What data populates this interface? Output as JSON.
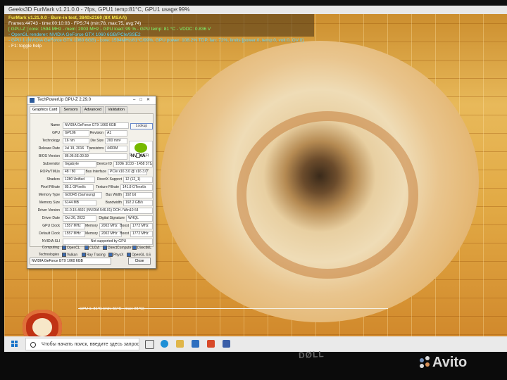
{
  "window": {
    "title": "Geeks3D FurMark v1.21.0.0 - 7fps, GPU1 temp:81°C, GPU1 usage:99%"
  },
  "hud": {
    "line1": "FurMark v1.21.0.0 - Burn-in test, 3840x2160 (8X MSAA)",
    "line2": "Frames:44743 - time:00:10:03 - FPS:74 (min:78, max:75, avg:74)",
    "line3": "[ GPU-Z ] core: 1594 MHz - mem: 2003 MHz - GPU load: 99 % - GPU temp: 81 °C - VDDC: 0.836 V",
    "line4": "- OpenGL renderer: NVIDIA GeForce GTX 1060 6GB/PCIe/SSE2",
    "line5": "- GPU 1 (NVIDIA GeForce GTX 1060 6GB) - core: 1594MHz/81°C/99%, GPU power: 108.2% TDP, fan: 72%, limits:[power:0, temp:0, volt:0, OV:0]",
    "line6": "- F1: toggle help",
    "graph_label": "GPU 1: 81°C (min: 51°C - max: 81°C)",
    "colors": {
      "yellow": "#f7e94a",
      "white": "#ffffff",
      "cyan": "#5ad6ff",
      "green": "#7cff72"
    }
  },
  "gpuz": {
    "title": "TechPowerUp GPU-Z 2.29.0",
    "tabs": [
      "Graphics Card",
      "Sensors",
      "Advanced",
      "Validation"
    ],
    "lookup": "Lookup",
    "nvidia": "NVIDIA",
    "uefi": "UEFI",
    "rows": {
      "name": {
        "label": "Name",
        "value": "NVIDIA GeForce GTX 1060 6GB"
      },
      "gpu": {
        "label": "GPU",
        "value": "GP106",
        "sub_label": "Revision",
        "sub_value": "A1"
      },
      "tech": {
        "label": "Technology",
        "value": "16 nm",
        "sub_label": "Die Size",
        "sub_value": "200 mm²"
      },
      "release": {
        "label": "Release Date",
        "value": "Jul 19, 2016",
        "sub_label": "Transistors",
        "sub_value": "4400M"
      },
      "bios": {
        "label": "BIOS Version",
        "value": "86.06.6E.00.59"
      },
      "subvendor": {
        "label": "Subvendor",
        "value": "Gigabyte",
        "sub_label": "Device ID",
        "sub_value": "10DE 1C03 - 1458 371A"
      },
      "rops": {
        "label": "ROPs/TMUs",
        "value": "48 / 80",
        "sub_label": "Bus Interface",
        "sub_value": "PCIe x16 3.0 @ x16 3.0"
      },
      "shaders": {
        "label": "Shaders",
        "value": "1280 Unified",
        "sub_label": "DirectX Support",
        "sub_value": "12 (12_1)"
      },
      "pixel": {
        "label": "Pixel Fillrate",
        "value": "85.1 GPixel/s",
        "sub_label": "Texture Fillrate",
        "sub_value": "141.8 GTexel/s"
      },
      "memtype": {
        "label": "Memory Type",
        "value": "GDDR5 (Samsung)",
        "sub_label": "Bus Width",
        "sub_value": "192 bit"
      },
      "memsize": {
        "label": "Memory Size",
        "value": "6144 MB",
        "sub_label": "Bandwidth",
        "sub_value": "192.2 GB/s"
      },
      "driver": {
        "label": "Driver Version",
        "value": "31.0.15.4601 (NVIDIA 546.01) DCH / Win10 64"
      },
      "ddate": {
        "label": "Driver Date",
        "value": "Oct 26, 2023",
        "sub_label": "Digital Signature",
        "sub_value": "WHQL"
      },
      "gclock": {
        "label": "GPU Clock",
        "value": "1557 MHz",
        "mem_label": "Memory",
        "mem_value": "2002 MHz",
        "boost_label": "Boost",
        "boost_value": "1772 MHz"
      },
      "dclock": {
        "label": "Default Clock",
        "value": "1557 MHz",
        "mem_label": "Memory",
        "mem_value": "2002 MHz",
        "boost_label": "Boost",
        "boost_value": "1772 MHz"
      },
      "sli": {
        "label": "NVIDIA SLI",
        "value": "Not supported by GPU"
      }
    },
    "computing_label": "Computing",
    "computing": [
      "OpenCL",
      "CUDA",
      "DirectCompute",
      "DirectML"
    ],
    "tech_label": "Technologies",
    "technologies": [
      "Vulkan",
      "Ray Tracing",
      "PhysX",
      "OpenGL 4.6"
    ],
    "selected_gpu": "NVIDIA GeForce GTX 1060 6GB",
    "close": "Close"
  },
  "taskbar": {
    "search_placeholder": "Чтобы начать поиск, введите здесь запрос"
  },
  "bezel": {
    "brand": "DØLL"
  },
  "watermark": {
    "text": "Avito"
  }
}
